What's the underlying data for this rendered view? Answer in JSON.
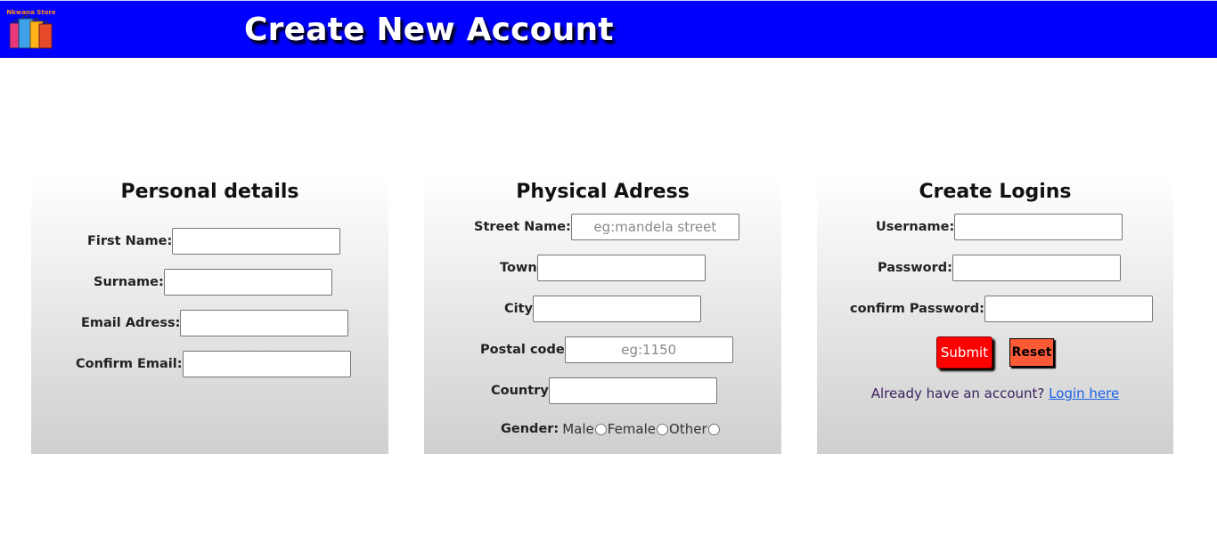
{
  "header": {
    "title": "Create New Account",
    "logo_text": "Nkwana Store",
    "background": "#0000ff"
  },
  "personal": {
    "heading": "Personal details",
    "first_name_label": "First Name:",
    "surname_label": "Surname:",
    "email_label": "Email Adress:",
    "confirm_email_label": "Confirm Email:"
  },
  "address": {
    "heading": "Physical Adress",
    "street_label": "Street Name:",
    "street_placeholder": "eg:mandela street",
    "town_label": "Town",
    "city_label": "City",
    "postal_label": "Postal code",
    "postal_placeholder": "eg:1150",
    "country_label": "Country",
    "gender_label": "Gender:",
    "gender_options": [
      "Male",
      "Female",
      "Other"
    ]
  },
  "logins": {
    "heading": "Create Logins",
    "username_label": "Username:",
    "password_label": "Password:",
    "confirm_password_label": "confirm Password:",
    "submit_label": "Submit",
    "reset_label": "Reset",
    "already_text": "Already have an account?",
    "login_link": "Login here"
  },
  "colors": {
    "submit": "#ff0000",
    "reset": "#ff5a36",
    "link": "#1a62e8"
  }
}
